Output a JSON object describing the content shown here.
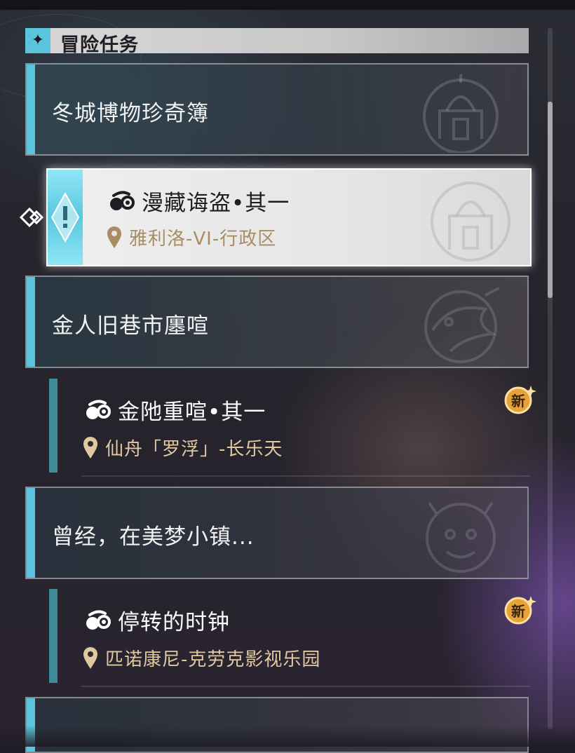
{
  "header": {
    "title": "冒险任务",
    "icon": "diamond-star-icon"
  },
  "categories": [
    {
      "title": "冬城博物珍奇簿",
      "emblem": "palace-emblem"
    },
    {
      "title": "金人旧巷市廛喧",
      "emblem": "bird-emblem"
    },
    {
      "title": "曾经，在美梦小镇...",
      "emblem": "clock-mascot-emblem"
    }
  ],
  "quests": [
    {
      "title": "漫藏诲盗•其一",
      "location": "雅利洛-VI-行政区",
      "selected": true,
      "new": false
    },
    {
      "title": "金阤重喧•其一",
      "location": "仙舟「罗浮」-长乐天",
      "selected": false,
      "new": true
    },
    {
      "title": "停转的时钟",
      "location": "匹诺康尼-克劳克影视乐园",
      "selected": false,
      "new": true
    }
  ],
  "badge": {
    "label": "新"
  },
  "colors": {
    "accent": "#5ac4dc",
    "bar": "#3f8a99",
    "location_text": "#e0c9a0",
    "badge": "#e6a33a"
  }
}
